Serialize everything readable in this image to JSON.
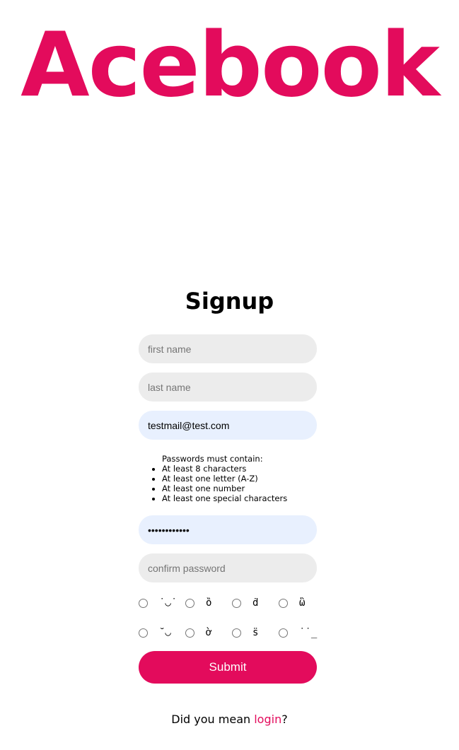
{
  "brand": {
    "name": "Acebook"
  },
  "form": {
    "title": "Signup",
    "first_name": {
      "value": "",
      "placeholder": "first name"
    },
    "last_name": {
      "value": "",
      "placeholder": "last name"
    },
    "email": {
      "value": "testmail@test.com",
      "placeholder": ""
    },
    "password_rules": {
      "heading": "Passwords must contain:",
      "items": [
        "At least 8 characters",
        "At least one letter (A-Z)",
        "At least one number",
        "At least one special characters"
      ]
    },
    "password": {
      "value": "••••••••••••",
      "placeholder": ""
    },
    "confirm_password": {
      "value": "",
      "placeholder": "confirm password"
    },
    "avatar_options": [
      [
        {
          "face": "˙◡˙",
          "selected": false
        },
        {
          "face": "ȍ",
          "selected": false
        },
        {
          "face": "ḋ",
          "selected": false
        },
        {
          "face": "ὣ",
          "selected": false
        }
      ],
      [
        {
          "face": "˘◡",
          "selected": false
        },
        {
          "face": "ờ",
          "selected": false
        },
        {
          "face": "s̈",
          "selected": false
        },
        {
          "face": "˙˙̲",
          "selected": false
        }
      ]
    ],
    "submit_label": "Submit"
  },
  "footer": {
    "prefix": "Did you mean ",
    "link_label": "login",
    "suffix": "?"
  },
  "colors": {
    "accent": "#e30b5c",
    "field_bg": "#ececec",
    "autofill_bg": "#e8f0fe"
  }
}
